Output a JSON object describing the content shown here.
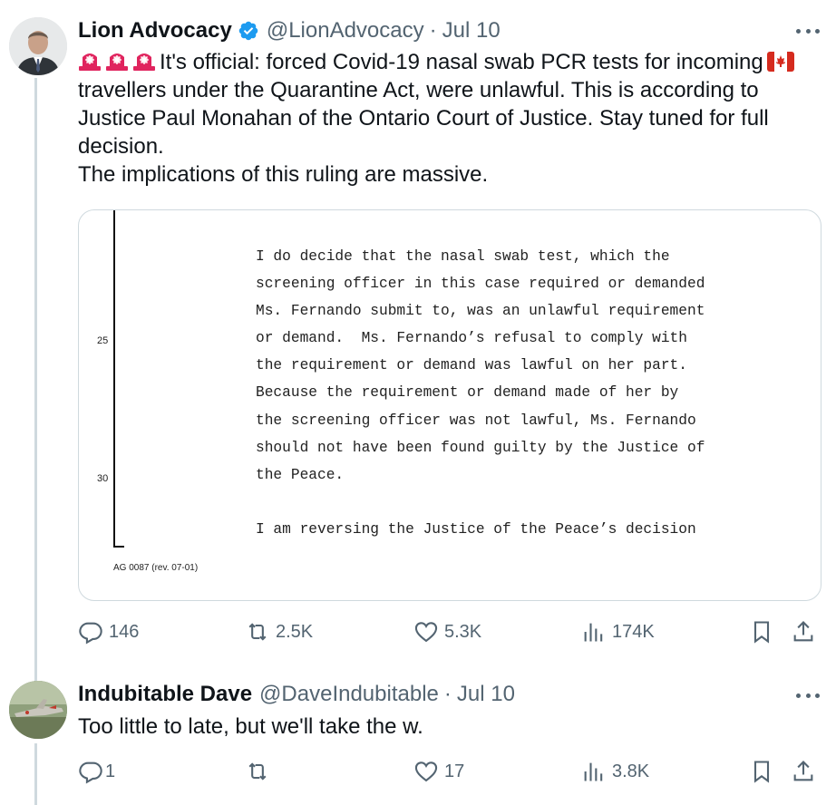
{
  "main_tweet": {
    "author_name": "Lion Advocacy",
    "handle": "@LionAdvocacy",
    "separator": "·",
    "date": "Jul 10",
    "text_line1": "It's official: forced Covid-19 nasal swab PCR tests for incoming",
    "text_rest": "travellers under the Quarantine Act, were unlawful. This is according to Justice Paul Monahan of the Ontario Court of Justice. Stay tuned for full decision.",
    "text_last": "The implications of this ruling are massive.",
    "document": {
      "line_numbers": [
        "25",
        "30"
      ],
      "footer": "AG 0087 (rev. 07-01)",
      "lines": [
        "I do decide that the nasal swab test, which the",
        "screening officer in this case required or demanded",
        "Ms. Fernando submit to, was an unlawful requirement",
        "or demand.  Ms. Fernando’s refusal to comply with",
        "the requirement or demand was lawful on her part.",
        "Because the requirement or demand made of her by",
        "the screening officer was not lawful, Ms. Fernando",
        "should not have been found guilty by the Justice of",
        "the Peace.",
        "",
        "I am reversing the Justice of the Peace’s decision"
      ]
    },
    "stats": {
      "replies": "146",
      "reposts": "2.5K",
      "likes": "5.3K",
      "views": "174K"
    }
  },
  "reply_tweet": {
    "author_name": "Indubitable Dave",
    "handle": "@DaveIndubitable",
    "separator": "·",
    "date": "Jul 10",
    "text": "Too little to late, but we'll take the w.",
    "stats": {
      "replies": "1",
      "reposts": "",
      "likes": "17",
      "views": "3.8K"
    }
  },
  "icons": {
    "verified": "verified-badge-icon",
    "more": "more-icon",
    "reply": "reply-icon",
    "repost": "repost-icon",
    "like": "heart-icon",
    "views": "views-chart-icon",
    "bookmark": "bookmark-icon",
    "share": "share-icon",
    "emoji_siren": "rotating-light-emoji",
    "emoji_flag": "canada-flag-emoji"
  },
  "colors": {
    "text": "#0f1419",
    "secondary": "#536471",
    "verified": "#1d9bf0",
    "border": "#cfd9de",
    "siren": "#e0245e",
    "flag": "#d52b1e"
  }
}
